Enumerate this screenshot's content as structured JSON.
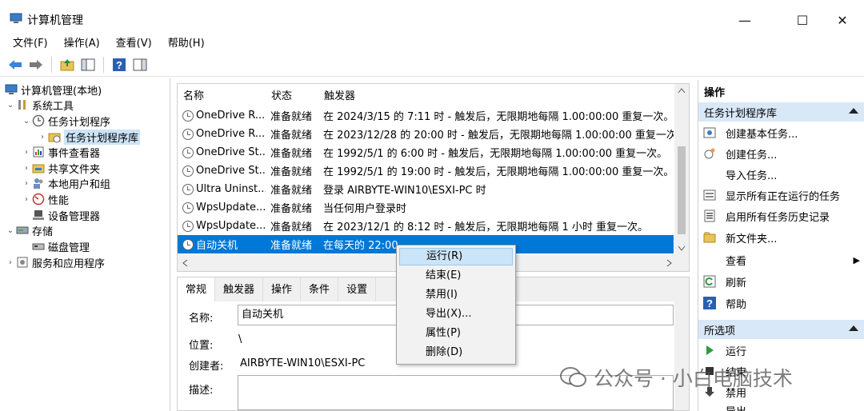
{
  "window": {
    "title": "计算机管理",
    "minimize": "—",
    "maximize": "☐",
    "close": "✕"
  },
  "menu": [
    "文件(F)",
    "操作(A)",
    "查看(V)",
    "帮助(H)"
  ],
  "tree": {
    "root": "计算机管理(本地)",
    "system_tools": "系统工具",
    "task_scheduler": "任务计划程序",
    "task_library": "任务计划程序库",
    "event_viewer": "事件查看器",
    "shared_folders": "共享文件夹",
    "local_users": "本地用户和组",
    "performance": "性能",
    "device_manager": "设备管理器",
    "storage": "存储",
    "disk_management": "磁盘管理",
    "services_apps": "服务和应用程序"
  },
  "list": {
    "headers": [
      "名称",
      "状态",
      "触发器"
    ],
    "rows": [
      {
        "name": "OneDrive R...",
        "status": "准备就绪",
        "trigger": "在 2024/3/15 的 7:11 时 - 触发后，无限期地每隔 1.00:00:00 重复一次。"
      },
      {
        "name": "OneDrive R...",
        "status": "准备就绪",
        "trigger": "在 2023/12/28 的 20:00 时 - 触发后，无限期地每隔 1.00:00:00 重复一次。"
      },
      {
        "name": "OneDrive St...",
        "status": "准备就绪",
        "trigger": "在 1992/5/1 的 6:00 时 - 触发后，无限期地每隔 1.00:00:00 重复一次。"
      },
      {
        "name": "OneDrive St...",
        "status": "准备就绪",
        "trigger": "在 1992/5/1 的 19:00 时 - 触发后，无限期地每隔 1.00:00:00 重复一次。"
      },
      {
        "name": "Ultra Uninst...",
        "status": "准备就绪",
        "trigger": "登录 AIRBYTE-WIN10\\ESXI-PC 时"
      },
      {
        "name": "WpsUpdate...",
        "status": "准备就绪",
        "trigger": "当任何用户登录时"
      },
      {
        "name": "WpsUpdate...",
        "status": "准备就绪",
        "trigger": "在 2023/12/1 的 8:12 时 - 触发后，无限期地每隔 1 小时 重复一次。"
      },
      {
        "name": "自动关机",
        "status": "准备就绪",
        "trigger": "在每天的 22:00"
      }
    ]
  },
  "detail": {
    "tabs": [
      "常规",
      "触发器",
      "操作",
      "条件",
      "设置"
    ],
    "name_label": "名称:",
    "name_value": "自动关机",
    "location_label": "位置:",
    "location_value": "\\",
    "author_label": "创建者:",
    "author_value": "AIRBYTE-WIN10\\ESXI-PC",
    "desc_label": "描述:"
  },
  "actions": {
    "header": "操作",
    "section1": "任务计划程序库",
    "items1": [
      "创建基本任务...",
      "创建任务...",
      "导入任务...",
      "显示所有正在运行的任务",
      "启用所有任务历史记录",
      "新文件夹...",
      "查看",
      "刷新",
      "帮助"
    ],
    "section2": "所选项",
    "items2": [
      "运行",
      "结束",
      "禁用",
      "导出..."
    ]
  },
  "context_menu": [
    "运行(R)",
    "结束(E)",
    "禁用(I)",
    "导出(X)...",
    "属性(P)",
    "删除(D)"
  ],
  "watermark": "公众号 · 小白电脑技术",
  "colors": {
    "selection": "#0078d7",
    "highlight": "#cce4f7",
    "section_bg": "#d9e8f7"
  }
}
